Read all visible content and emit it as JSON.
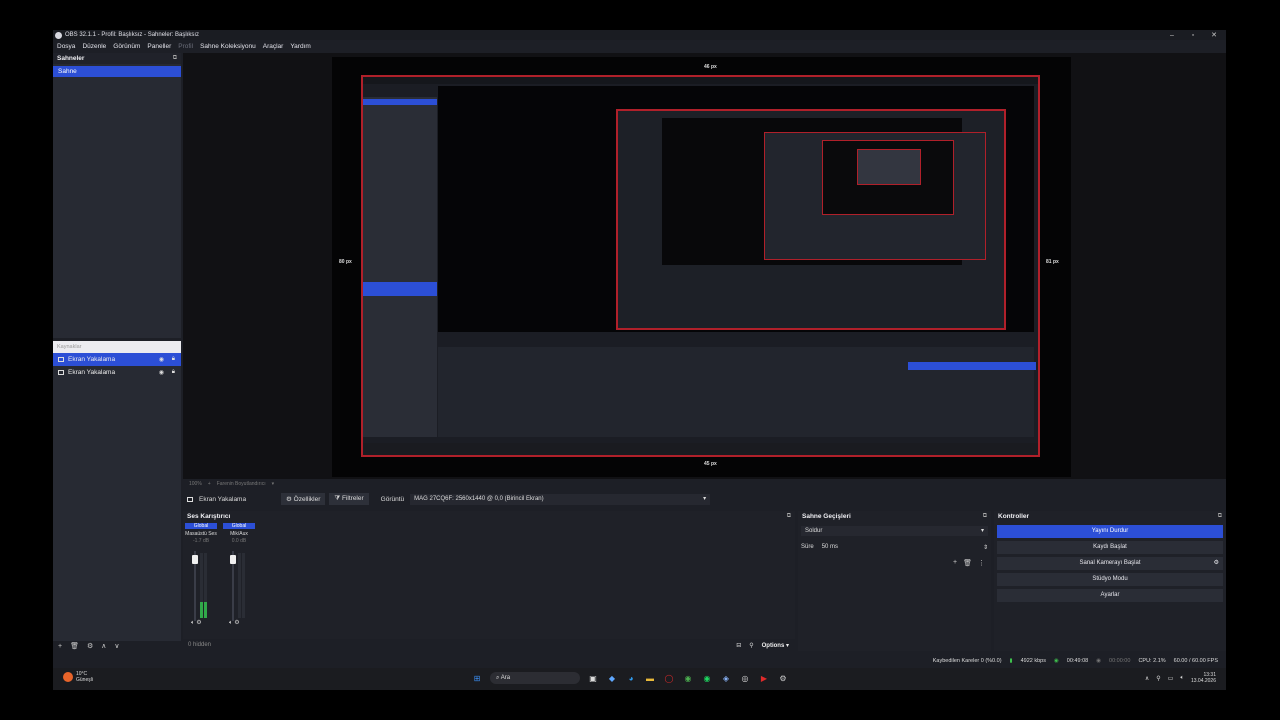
{
  "window": {
    "title": "OBS 32.1.1 - Profil: Başlıksız - Sahneler: Başlıksız",
    "controls": [
      "–",
      "▫",
      "✕"
    ]
  },
  "menu": [
    "Dosya",
    "Düzenle",
    "Görünüm",
    "Paneller",
    "Profil",
    "Sahne Koleksiyonu",
    "Araçlar",
    "Yardım"
  ],
  "scenes": {
    "header": "Sahneler",
    "items": [
      "Sahne"
    ]
  },
  "sources": {
    "search_placeholder": "Kaynaklar",
    "items": [
      {
        "name": "Ekran Yakalama",
        "selected": true
      },
      {
        "name": "Ekran Yakalama",
        "selected": false
      }
    ]
  },
  "preview": {
    "labels": {
      "top": "46 px",
      "bottom": "45 px",
      "left": "80 px",
      "right": "81 px"
    },
    "footer": [
      "100%",
      "Farenin Boyutlandırıcı"
    ]
  },
  "source_toolbar": {
    "source_name": "Ekran Yakalama",
    "properties": "Özellikler",
    "filters": "Filtreler",
    "display_label": "Görüntü",
    "display_value": "MAG 27CQ6F: 2560x1440 @ 0,0 (Birincil Ekran)"
  },
  "audio_mixer": {
    "header": "Ses Karıştırıcı",
    "channels": [
      {
        "scope": "Global",
        "db": "-1.7 dB",
        "name": "Masaüstü Ses",
        "level": 0.25
      },
      {
        "scope": "Global",
        "db": "0.0 dB",
        "name": "Mik/Aux",
        "level": 0.0
      }
    ],
    "footer_left": "0 hidden",
    "options": "Options"
  },
  "transitions": {
    "header": "Sahne Geçişleri",
    "selected": "Soldur",
    "duration_label": "Süre",
    "duration_value": "50 ms"
  },
  "controls": {
    "header": "Kontroller",
    "buttons": [
      "Yayını Durdur",
      "Kaydı Başlat",
      "Sanal Kamerayı Başlat",
      "Stüdyo Modu",
      "Ayarlar"
    ]
  },
  "status": {
    "dropped": "Kaybedilen Kareler 0 (%0.0)",
    "bitrate": "4922 kbps",
    "stream_time": "00:49:08",
    "rec_time": "00:00:00",
    "cpu": "CPU: 2.1%",
    "fps": "60.00 / 60.00 FPS"
  },
  "taskbar": {
    "weather_temp": "10°C",
    "weather_desc": "Güneşli",
    "search": "Ara",
    "time": "13:31",
    "date": "13.04.2026"
  },
  "colors": {
    "accent": "#2c4fd6",
    "crop_border": "#b0202a",
    "meter_green": "#31a84a"
  }
}
